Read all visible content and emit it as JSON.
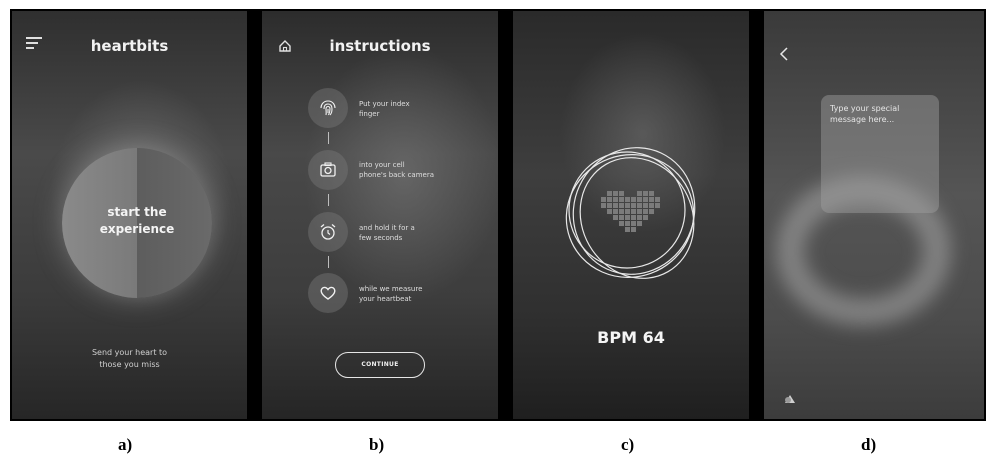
{
  "screens": {
    "a": {
      "title": "heartbits",
      "start_label_line1": "start the",
      "start_label_line2": "experience",
      "footer_line1": "Send your heart to",
      "footer_line2": "those you miss",
      "menu_icon": "hamburger-menu-icon"
    },
    "b": {
      "title": "instructions",
      "home_icon": "home-icon",
      "steps": [
        {
          "icon": "fingerprint-icon",
          "line1": "Put your index",
          "line2": "finger"
        },
        {
          "icon": "camera-icon",
          "line1": "into your cell",
          "line2": "phone's back camera"
        },
        {
          "icon": "alarm-clock-icon",
          "line1": "and hold it for a",
          "line2": "few seconds"
        },
        {
          "icon": "heart-outline-icon",
          "line1": "while we measure",
          "line2": "your heartbeat"
        }
      ],
      "continue_label": "CONTINUE"
    },
    "c": {
      "bpm_label": "BPM 64",
      "heart_icon": "pixel-heart-icon"
    },
    "d": {
      "back_icon": "back-chevron-icon",
      "message_placeholder_line1": "Type your special",
      "message_placeholder_line2": "message here..."
    }
  },
  "captions": [
    "a)",
    "b)",
    "c)",
    "d)"
  ]
}
